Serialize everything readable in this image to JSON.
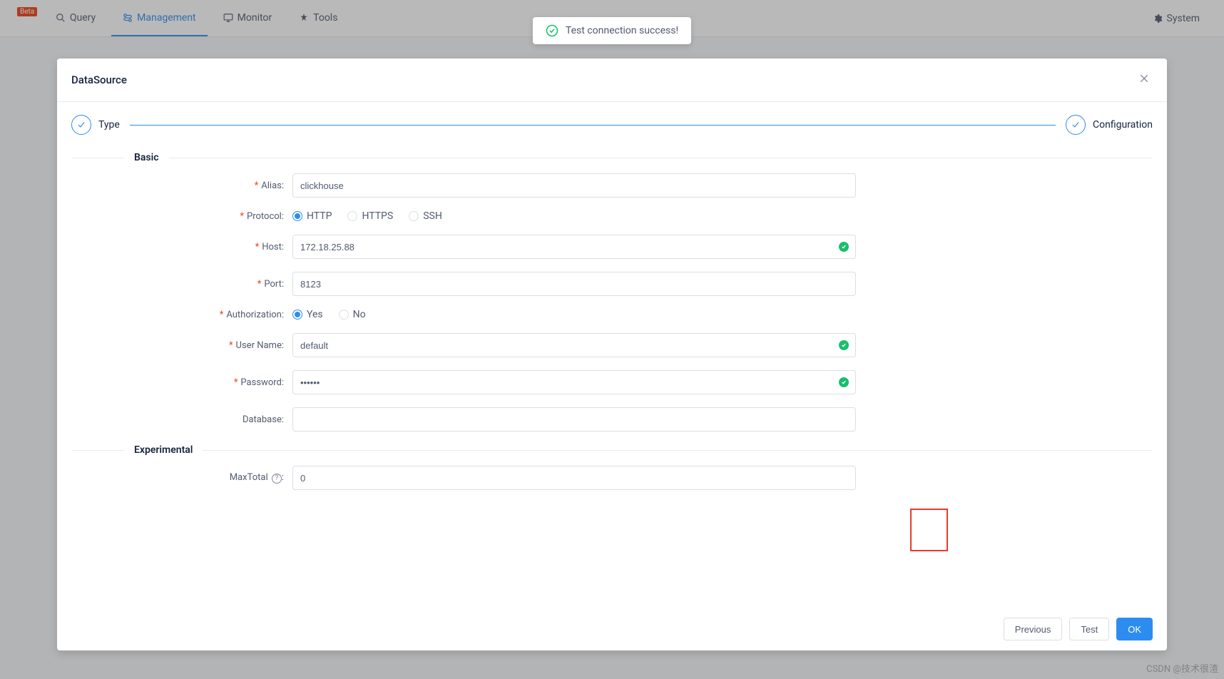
{
  "header": {
    "brand": "Beta",
    "nav": {
      "query": "Query",
      "management": "Management",
      "monitor": "Monitor",
      "tools": "Tools"
    },
    "system": "System"
  },
  "toast": {
    "message": "Test connection success!"
  },
  "modal": {
    "title": "DataSource",
    "steps": {
      "type": "Type",
      "configuration": "Configuration"
    },
    "sections": {
      "basic": "Basic",
      "experimental": "Experimental"
    },
    "labels": {
      "alias": "Alias:",
      "protocol": "Protocol:",
      "host": "Host:",
      "port": "Port:",
      "authorization": "Authorization:",
      "username": "User Name:",
      "password": "Password:",
      "database": "Database:",
      "maxtotal": "MaxTotal"
    },
    "values": {
      "alias": "clickhouse",
      "host": "172.18.25.88",
      "port": "8123",
      "username": "default",
      "password": "••••••",
      "database": "",
      "maxtotal": "0"
    },
    "protocol_options": {
      "http": "HTTP",
      "https": "HTTPS",
      "ssh": "SSH"
    },
    "auth_options": {
      "yes": "Yes",
      "no": "No"
    },
    "buttons": {
      "previous": "Previous",
      "test": "Test",
      "ok": "OK"
    }
  },
  "watermark": "CSDN @技术很渣"
}
